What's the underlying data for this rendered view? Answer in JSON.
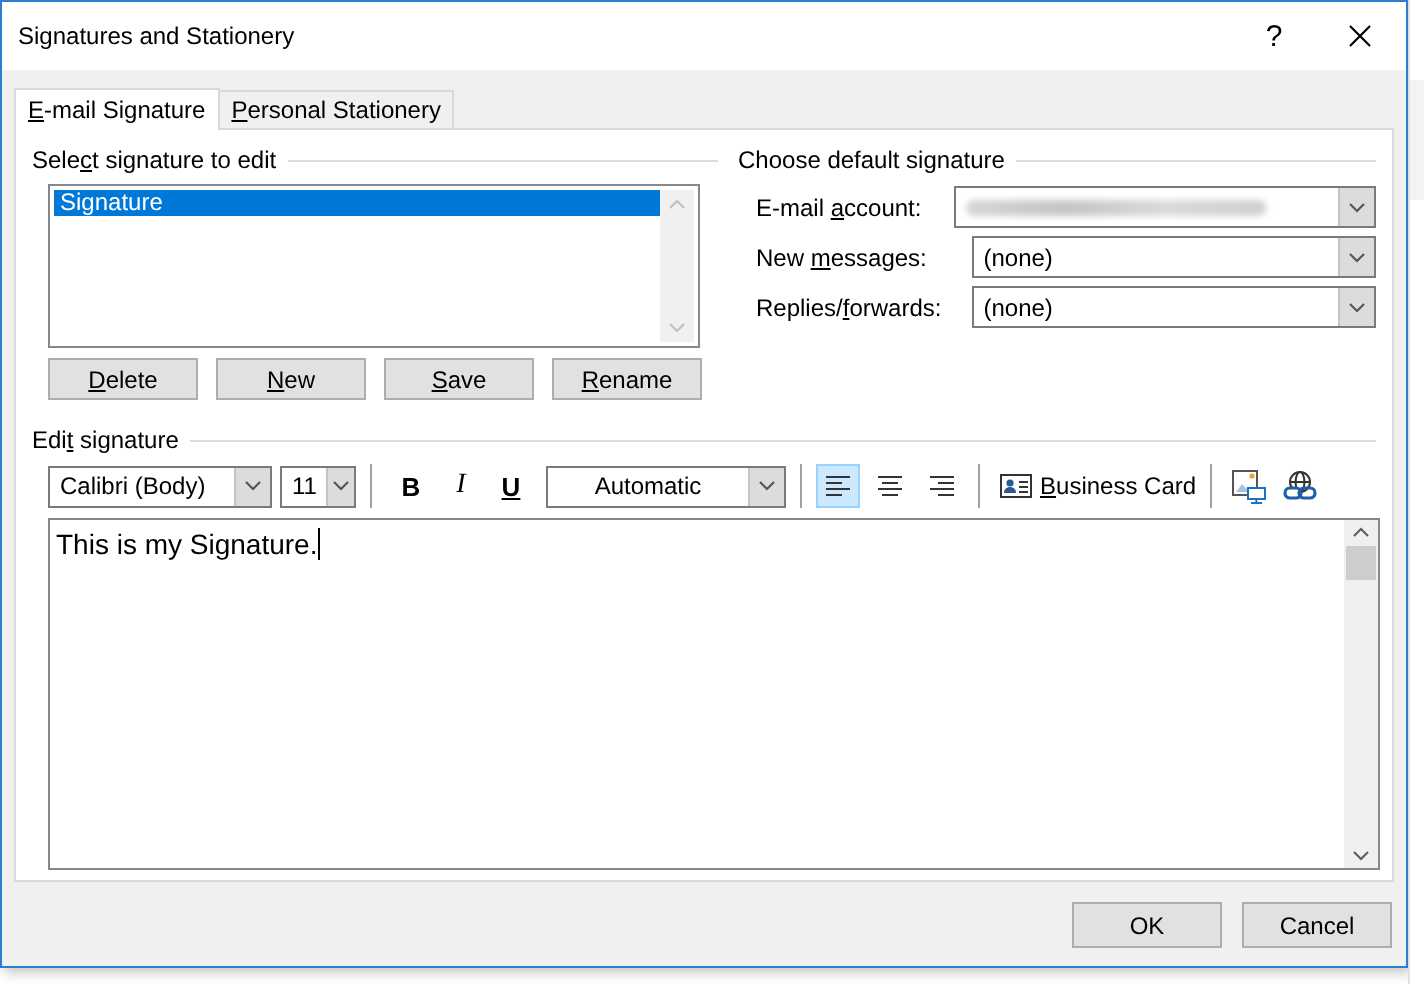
{
  "window": {
    "title": "Signatures and Stationery",
    "help": "?"
  },
  "tabs": [
    {
      "label": "E-mail Signature",
      "selected": true
    },
    {
      "label": "Personal Stationery",
      "selected": false
    }
  ],
  "select_signature": {
    "label": "Select signature to edit",
    "items": [
      {
        "label": "Signature",
        "selected": true
      }
    ],
    "buttons": [
      {
        "label": "Delete"
      },
      {
        "label": "New"
      },
      {
        "label": "Save"
      },
      {
        "label": "Rename"
      }
    ]
  },
  "default_signature": {
    "label": "Choose default signature",
    "fields": [
      {
        "label": "E-mail account:",
        "kind": "blurred"
      },
      {
        "label": "New messages:",
        "kind": "text",
        "value": "(none)"
      },
      {
        "label": "Replies/forwards:",
        "kind": "text",
        "value": "(none)"
      }
    ]
  },
  "edit_signature": {
    "label": "Edit signature",
    "font": "Calibri (Body)",
    "size": "11",
    "format_buttons": [
      {
        "label": "B",
        "kind": "bold"
      },
      {
        "label": "I",
        "kind": "italic"
      },
      {
        "label": "U",
        "kind": "underline"
      }
    ],
    "font_color_label": "Automatic",
    "align": [
      {
        "kind": "left",
        "selected": true
      },
      {
        "kind": "center",
        "selected": false
      },
      {
        "kind": "right",
        "selected": false
      }
    ],
    "business_card": {
      "label": "Business Card"
    },
    "body": "This is my Signature."
  },
  "buttons": [
    "OK",
    "Cancel"
  ]
}
